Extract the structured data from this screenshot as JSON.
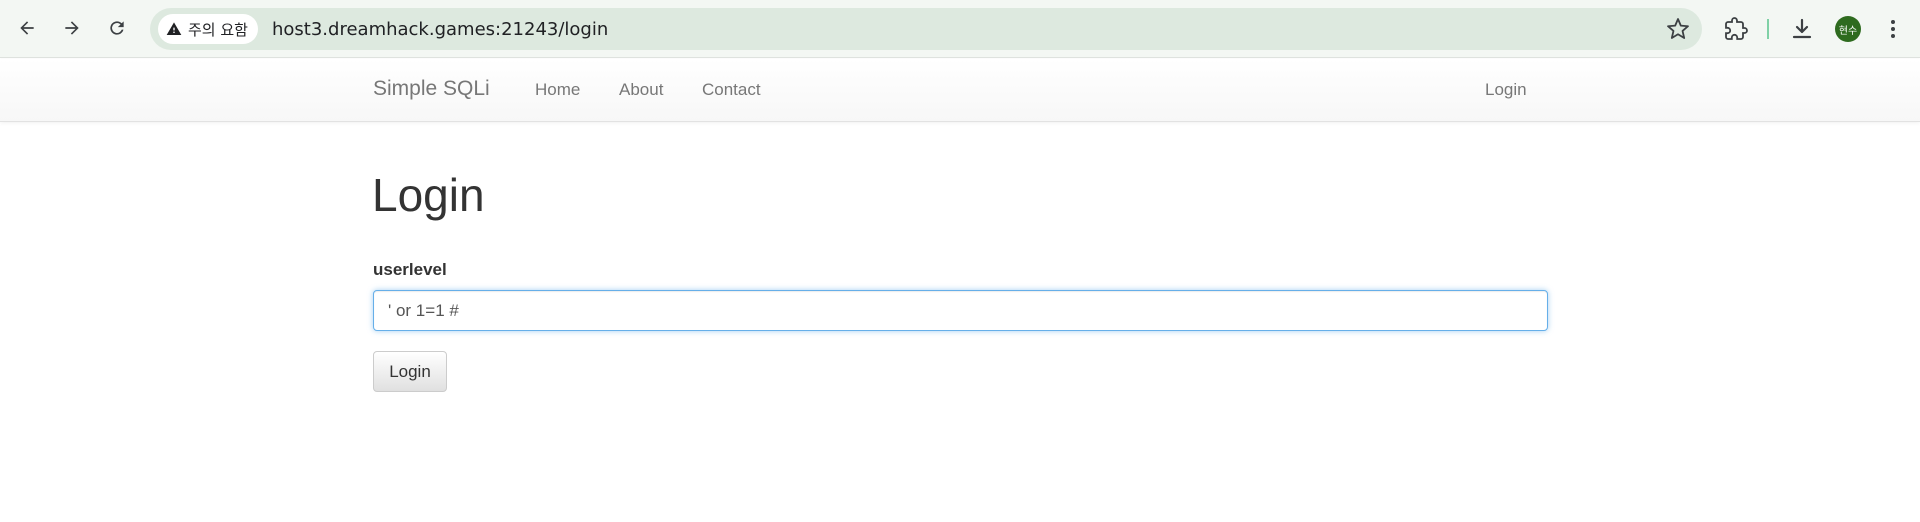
{
  "browser": {
    "security_label": "주의 요함",
    "url": "host3.dreamhack.games:21243/login",
    "profile_initials": "현수"
  },
  "site_nav": {
    "brand": "Simple SQLi",
    "links": [
      "Home",
      "About",
      "Contact"
    ],
    "right_link": "Login"
  },
  "main": {
    "title": "Login",
    "field_label": "userlevel",
    "field_value": "' or 1=1 #",
    "submit_label": "Login"
  },
  "colors": {
    "focus_border": "#66afe9",
    "chrome_bg": "#f3f7f3",
    "omnibox_bg": "#dde9df",
    "avatar_bg": "#2e6b1f"
  },
  "icons": [
    "back-arrow-icon",
    "forward-arrow-icon",
    "reload-icon",
    "warning-icon",
    "star-icon",
    "extensions-icon",
    "download-icon",
    "more-vert-icon"
  ]
}
